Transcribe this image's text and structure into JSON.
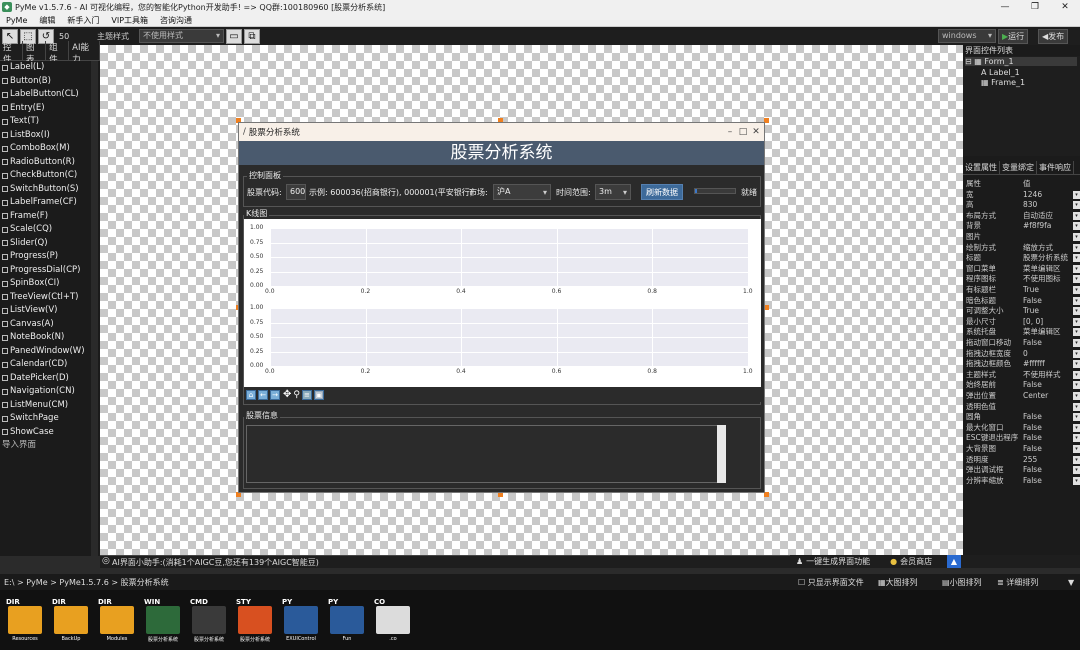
{
  "app": {
    "title": "PyMe v1.5.7.6 - AI 可视化编程，您的智能化Python开发助手!   => QQ群:100180960   [股票分析系统]"
  },
  "menu": [
    "PyMe",
    "编辑",
    "新手入门",
    "VIP工具箱",
    "咨询沟通"
  ],
  "toolbar": {
    "size_value": "50",
    "theme_label": "主题样式",
    "theme_value": "不使用样式",
    "platform_value": "windows",
    "run_label": "运行",
    "publish_label": "发布"
  },
  "left_tabs": [
    "控件",
    "图表",
    "组件",
    "AI能力"
  ],
  "widgets": [
    "Label(L)",
    "Button(B)",
    "LabelButton(CL)",
    "Entry(E)",
    "Text(T)",
    "ListBox(I)",
    "ComboBox(M)",
    "RadioButton(R)",
    "CheckButton(C)",
    "SwitchButton(S)",
    "LabelFrame(CF)",
    "Frame(F)",
    "Scale(CQ)",
    "Slider(Q)",
    "Progress(P)",
    "ProgressDial(CP)",
    "SpinBox(CI)",
    "TreeView(Ctl+T)",
    "ListView(V)",
    "Canvas(A)",
    "NoteBook(N)",
    "PanedWindow(W)",
    "Calendar(CD)",
    "DatePicker(D)",
    "Navigation(CN)",
    "ListMenu(CM)",
    "SwitchPage",
    "ShowCase",
    "导入界面"
  ],
  "form": {
    "title": "股票分析系统",
    "banner": "股票分析系统",
    "control_group": "控制面板",
    "code_label": "股票代码:",
    "code_value": "600",
    "example_text": "示例: 600036(招商银行), 000001(平安银行)",
    "market_label": "市场:",
    "market_value": "沪A",
    "range_label": "时间范围:",
    "range_value": "3m",
    "refresh_label": "刷新数据",
    "progress": 0.05,
    "status": "就绪",
    "kline_group": "K线图",
    "info_group": "股票信息"
  },
  "chart_data": [
    {
      "type": "line",
      "title": "",
      "xlabel": "",
      "ylabel": "",
      "xlim": [
        0,
        1
      ],
      "ylim": [
        0,
        1
      ],
      "x_ticks": [
        "0.0",
        "0.2",
        "0.4",
        "0.6",
        "0.8",
        "1.0"
      ],
      "y_ticks": [
        "0.00",
        "0.25",
        "0.50",
        "0.75",
        "1.00"
      ],
      "grid": true,
      "series": []
    },
    {
      "type": "line",
      "title": "",
      "xlabel": "",
      "ylabel": "",
      "xlim": [
        0,
        1
      ],
      "ylim": [
        0,
        1
      ],
      "x_ticks": [
        "0.0",
        "0.2",
        "0.4",
        "0.6",
        "0.8",
        "1.0"
      ],
      "y_ticks": [
        "0.00",
        "0.25",
        "0.50",
        "0.75",
        "1.00"
      ],
      "grid": true,
      "series": []
    }
  ],
  "right": {
    "title": "界面控件列表",
    "tree": [
      "Form_1",
      "Label_1",
      "Frame_1"
    ],
    "tabs": [
      "设置属性",
      "变量绑定",
      "事件响应"
    ],
    "props": [
      [
        "属性",
        "值"
      ],
      [
        "宽",
        "1246"
      ],
      [
        "高",
        "830"
      ],
      [
        "布局方式",
        "自动适应"
      ],
      [
        "背景",
        "#f8f9fa"
      ],
      [
        "图片",
        ""
      ],
      [
        "绘制方式",
        "缩放方式"
      ],
      [
        "标题",
        "股票分析系统"
      ],
      [
        "窗口菜单",
        "菜单编辑区"
      ],
      [
        "程序图标",
        "不使用图标"
      ],
      [
        "有标题栏",
        "True"
      ],
      [
        "暗色标题",
        "False"
      ],
      [
        "可调整大小",
        "True"
      ],
      [
        "最小尺寸",
        "[0, 0]"
      ],
      [
        "系统托盘",
        "菜单编辑区"
      ],
      [
        "拖动窗口移动",
        "False"
      ],
      [
        "拖拽边框宽度",
        "0"
      ],
      [
        "拖拽边框颜色",
        "#ffffff"
      ],
      [
        "主题样式",
        "不使用样式"
      ],
      [
        "始终居前",
        "False"
      ],
      [
        "弹出位置",
        "Center"
      ],
      [
        "透明色值",
        ""
      ],
      [
        "圆角",
        "False"
      ],
      [
        "最大化窗口",
        "False"
      ],
      [
        "ESC键退出程序",
        "False"
      ],
      [
        "大背景图",
        "False"
      ],
      [
        "透明度",
        "255"
      ],
      [
        "弹出调试框",
        "False"
      ],
      [
        "分辨率缩放",
        "False"
      ]
    ]
  },
  "assist": {
    "text": "AI界面小助手:(消耗1个AIGC豆,您还有139个AIGC智能豆)",
    "gen_label": "一键生成界面功能",
    "shop_label": "会员商店"
  },
  "path": "E:\\ > PyMe > PyMe1.5.7.6 > 股票分析系统",
  "view_opts": [
    "只显示界面文件",
    "大图排列",
    "小图排列",
    "详细排列"
  ],
  "files": [
    {
      "tag": "DIR",
      "name": "Resources",
      "color": "#e8a020"
    },
    {
      "tag": "DIR",
      "name": "BackUp",
      "color": "#e8a020"
    },
    {
      "tag": "DIR",
      "name": "Modules",
      "color": "#e8a020"
    },
    {
      "tag": "WIN",
      "name": "股票分析系统",
      "color": "#2d6a3a"
    },
    {
      "tag": "CMD",
      "name": "股票分析系统",
      "color": "#3a3a3a"
    },
    {
      "tag": "STY",
      "name": "股票分析系统",
      "color": "#d85020"
    },
    {
      "tag": "PY",
      "name": "EXUIControl",
      "color": "#2a5a9a"
    },
    {
      "tag": "PY",
      "name": "Fun",
      "color": "#2a5a9a"
    },
    {
      "tag": "CO",
      "name": ".co",
      "color": "#dcdcdc"
    }
  ]
}
